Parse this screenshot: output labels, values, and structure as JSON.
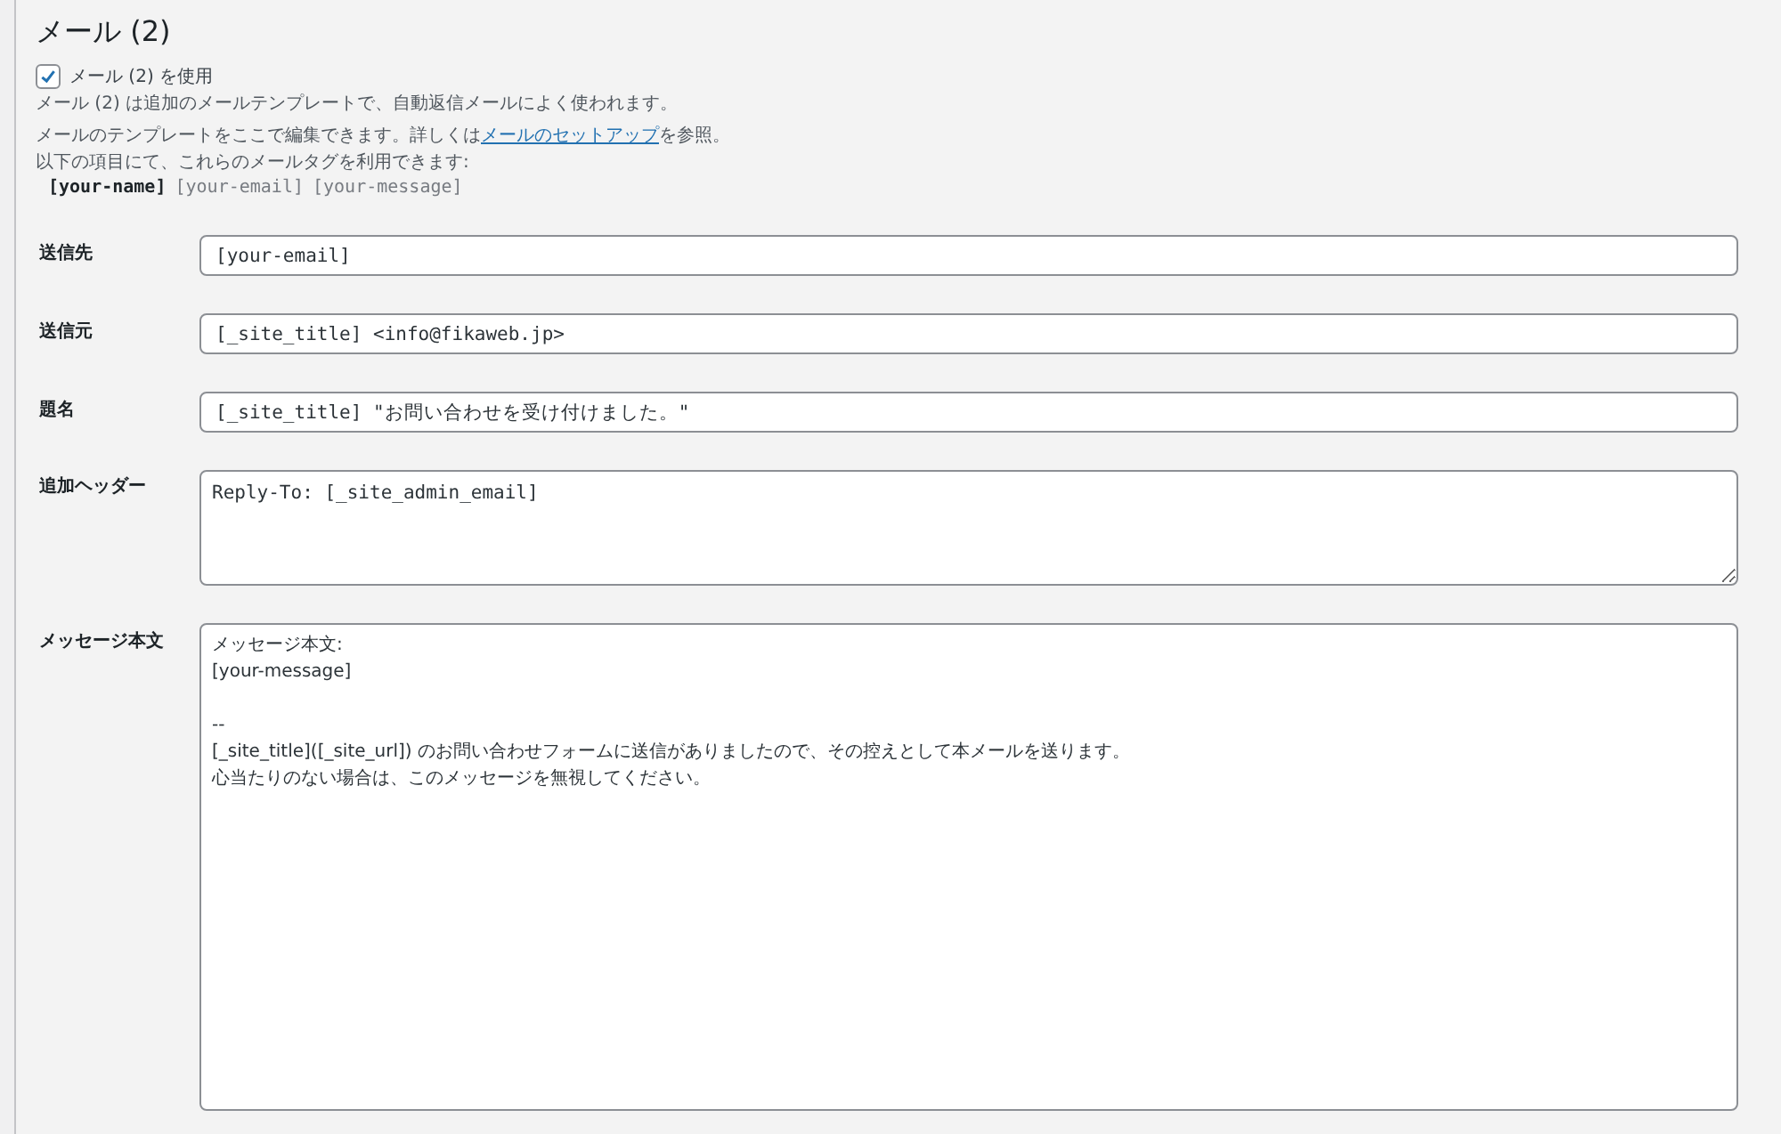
{
  "section": {
    "title": "メール (2)"
  },
  "use_checkbox": {
    "label": "メール (2) を使用",
    "checked": true
  },
  "description": "メール (2) は追加のメールテンプレートで、自動返信メールによく使われます。",
  "help": {
    "before": "メールのテンプレートをここで編集できます。詳しくは",
    "link": "メールのセットアップ",
    "after": "を参照。"
  },
  "tags_intro": "以下の項目にて、これらのメールタグを利用できます:",
  "tags": [
    {
      "text": "[your-name]",
      "used": true
    },
    {
      "text": "[your-email]",
      "used": false
    },
    {
      "text": "[your-message]",
      "used": false
    }
  ],
  "fields": [
    {
      "label": "送信先",
      "kind": "input",
      "value": "[your-email]"
    },
    {
      "label": "送信元",
      "kind": "input",
      "value": "[_site_title] <info@fikaweb.jp>"
    },
    {
      "label": "題名",
      "kind": "input",
      "value": "[_site_title] \"お問い合わせを受け付けました。\""
    },
    {
      "label": "追加ヘッダー",
      "kind": "textarea",
      "value": "Reply-To: [_site_admin_email]"
    },
    {
      "label": "メッセージ本文",
      "kind": "body",
      "paragraphs": [
        [
          "メッセージ本文:",
          "[your-message]"
        ],
        [
          "--",
          "[_site_title]([_site_url]) のお問い合わせフォームに送信がありましたので、その控えとして本メールを送ります。",
          "心当たりのない場合は、このメッセージを無視してください。"
        ]
      ]
    }
  ]
}
